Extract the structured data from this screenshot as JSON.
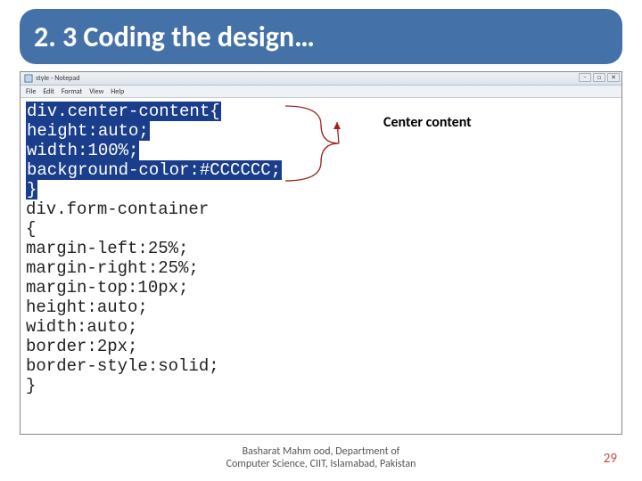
{
  "title": "2. 3 Coding the design…",
  "editor": {
    "title": "style - Notepad",
    "menu": [
      "File",
      "Edit",
      "Format",
      "View",
      "Help"
    ],
    "code_highlighted": [
      "div.center-content{",
      "height:auto;",
      "width:100%;",
      "background-color:#CCCCCC;",
      "}"
    ],
    "code_plain": [
      "div.form-container",
      "{",
      "margin-left:25%;",
      "margin-right:25%;",
      "margin-top:10px;",
      "height:auto;",
      "width:auto;",
      "border:2px;",
      "border-style:solid;",
      "}"
    ]
  },
  "callout_label": "Center content",
  "footer": {
    "line1": "Basharat Mahm ood, Department of",
    "line2": "Computer Science, CIIT, Islamabad, Pakistan"
  },
  "slide_number": "29",
  "win_controls": {
    "min": "–",
    "max": "□",
    "close": "✕"
  }
}
